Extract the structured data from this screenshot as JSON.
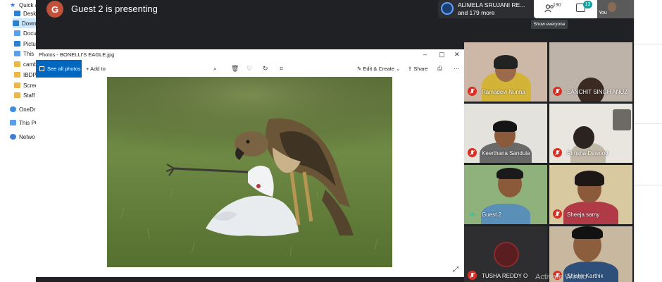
{
  "explorer": {
    "items": [
      {
        "label": "Quick a",
        "icon": "star-icon"
      },
      {
        "label": "Deskt",
        "icon": "desktop-folder-icon"
      },
      {
        "label": "Down",
        "icon": "download-icon"
      },
      {
        "label": "Docu",
        "icon": "documents-icon"
      },
      {
        "label": "Pictur",
        "icon": "pictures-icon"
      },
      {
        "label": "This P",
        "icon": "pc-icon"
      },
      {
        "label": "camb",
        "icon": "folder-icon"
      },
      {
        "label": "IBDP",
        "icon": "folder-icon"
      },
      {
        "label": "Scree",
        "icon": "folder-icon"
      },
      {
        "label": "Staff a",
        "icon": "folder-icon"
      },
      {
        "label": "OneDri",
        "icon": "cloud-icon"
      },
      {
        "label": "This PC",
        "icon": "pc-icon"
      },
      {
        "label": "Netwo",
        "icon": "network-icon"
      }
    ]
  },
  "meet": {
    "presenter_initial": "G",
    "presenting_text": "Guest 2 is presenting",
    "presenter_chip": {
      "line1": "ALIMELA SRUJANI RE...",
      "line2": "and 179 more"
    },
    "people_count": "190",
    "chat_count": "13",
    "tooltip": "Show everyone",
    "self_label": "You",
    "avatar_color": "#c0513a",
    "accent_color": "#1a9c9c"
  },
  "photos": {
    "title": "Photos - BONELLI'S EAGLE.jpg",
    "see_all": "See all photos",
    "add_to": "Add to",
    "edit_create": "Edit & Create",
    "share": "Share",
    "win_min": "–",
    "win_max": "▢",
    "win_close": "✕"
  },
  "participants": [
    {
      "name": "Ramadevi Nunna",
      "muted": true
    },
    {
      "name": "SANCHIT SINGH ANUZ",
      "muted": true
    },
    {
      "name": "Keerthana Sandula",
      "muted": true
    },
    {
      "name": "Rimsha Dawood",
      "muted": true
    },
    {
      "name": "Guest 2",
      "muted": false
    },
    {
      "name": "Sheeja samy",
      "muted": true
    },
    {
      "name": "TUSHA REDDY O",
      "muted": true
    },
    {
      "name": "Shishir Karthik",
      "muted": true
    }
  ],
  "watermark": "Activate Windo"
}
